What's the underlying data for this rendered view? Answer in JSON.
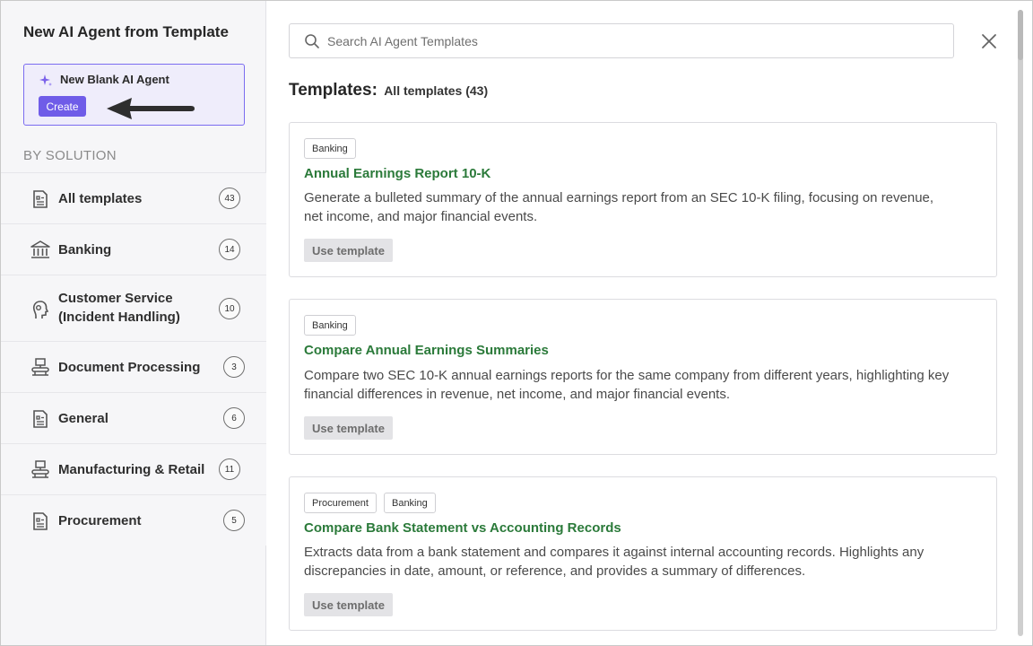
{
  "sidebar": {
    "title": "New AI Agent from Template",
    "blank_card": {
      "label": "New Blank AI Agent",
      "create_label": "Create",
      "spark_icon": "sparkle-icon",
      "accent_color": "#6f5ce8"
    },
    "section_label": "BY SOLUTION",
    "categories": [
      {
        "label": "All templates",
        "count": "43",
        "icon": "document-icon"
      },
      {
        "label": "Banking",
        "count": "14",
        "icon": "bank-icon"
      },
      {
        "label": "Customer Service (Incident Handling)",
        "label_line1": "Customer Service",
        "label_line2": "(Incident Handling)",
        "count": "10",
        "icon": "headset-icon"
      },
      {
        "label": "Document Processing",
        "count": "3",
        "icon": "conveyor-icon"
      },
      {
        "label": "General",
        "count": "6",
        "icon": "document-icon"
      },
      {
        "label": "Manufacturing & Retail",
        "count": "11",
        "icon": "conveyor-icon"
      },
      {
        "label": "Procurement",
        "count": "5",
        "icon": "document-icon"
      }
    ]
  },
  "main": {
    "search": {
      "placeholder": "Search AI Agent Templates",
      "icon": "search-icon"
    },
    "close_icon": "close-icon",
    "heading": "Templates:",
    "heading_sub": "All templates (43)",
    "title_color": "#2b7a3a",
    "templates": [
      {
        "tags": [
          "Banking"
        ],
        "title": "Annual Earnings Report 10-K",
        "description_line1": "Generate a bulleted summary of the annual earnings report from an SEC 10-K filing, focusing on revenue,",
        "description_line2": "net income, and major financial events.",
        "button": "Use template"
      },
      {
        "tags": [
          "Banking"
        ],
        "title": "Compare Annual Earnings Summaries",
        "description_line1": "Compare two SEC 10-K annual earnings reports for the same company from different years, highlighting key",
        "description_line2": "financial differences in revenue, net income, and major financial events.",
        "button": "Use template"
      },
      {
        "tags": [
          "Procurement",
          "Banking"
        ],
        "title": "Compare Bank Statement vs Accounting Records",
        "description_line1": "Extracts data from a bank statement and compares it against internal accounting records. Highlights any",
        "description_line2": "discrepancies in date, amount, or reference, and provides a summary of differences.",
        "button": "Use template"
      }
    ]
  }
}
